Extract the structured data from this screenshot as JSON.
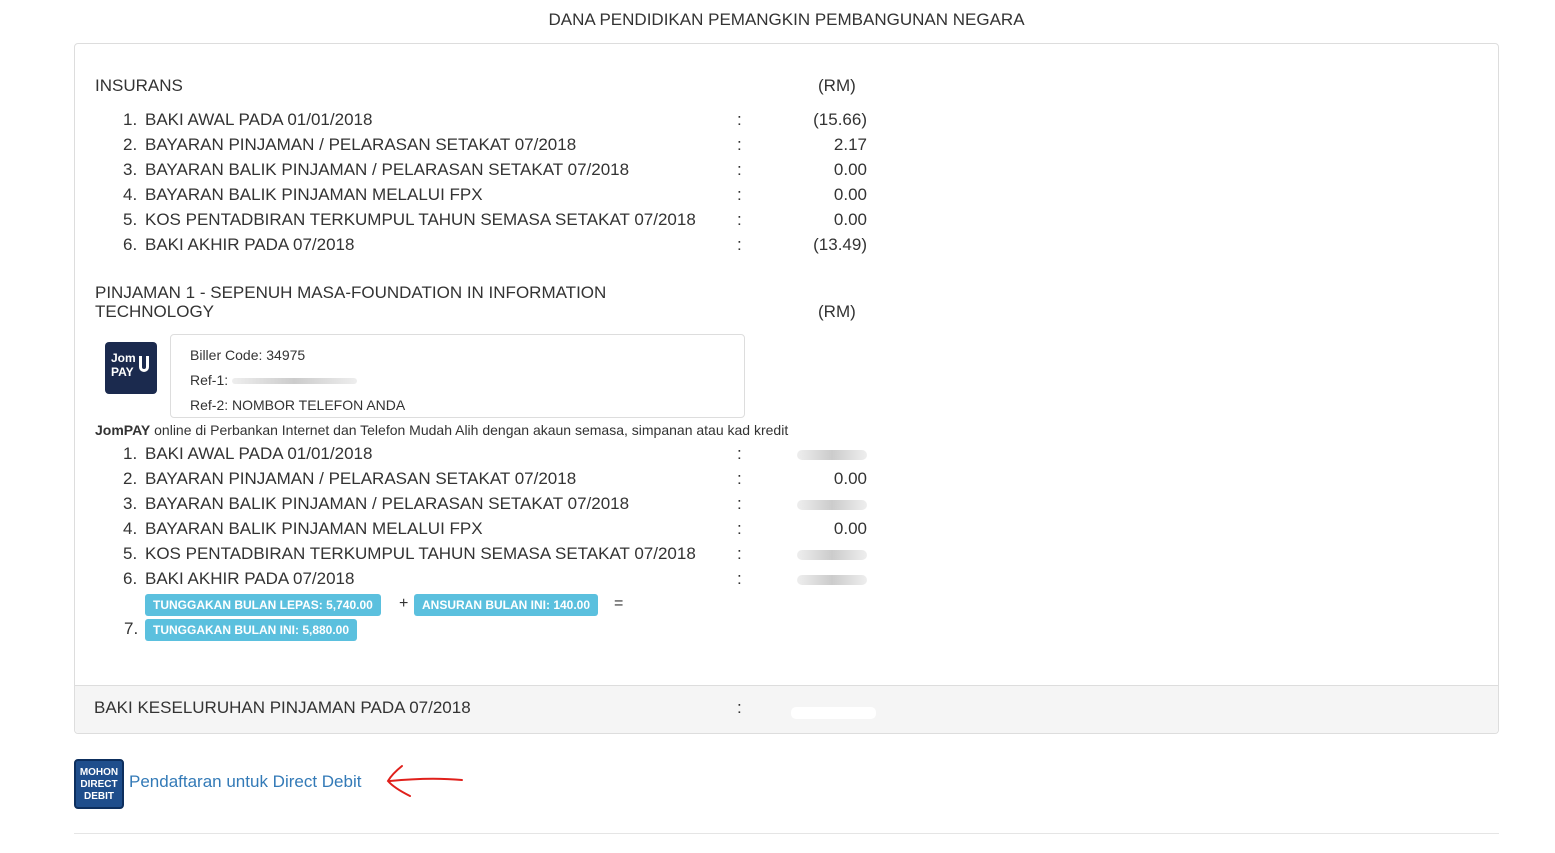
{
  "page_title": "DANA PENDIDIKAN PEMANGKIN PEMBANGUNAN NEGARA",
  "insurans": {
    "title": "INSURANS",
    "currency": "(RM)",
    "rows": [
      {
        "num": "1.",
        "label": "BAKI AWAL PADA 01/01/2018",
        "colon": ":",
        "value": "(15.66)"
      },
      {
        "num": "2.",
        "label": "BAYARAN PINJAMAN / PELARASAN SETAKAT 07/2018",
        "colon": ":",
        "value": "2.17"
      },
      {
        "num": "3.",
        "label": "BAYARAN BALIK PINJAMAN / PELARASAN SETAKAT 07/2018",
        "colon": ":",
        "value": "0.00"
      },
      {
        "num": "4.",
        "label": "BAYARAN BALIK PINJAMAN MELALUI FPX",
        "colon": ":",
        "value": "0.00"
      },
      {
        "num": "5.",
        "label": "KOS PENTADBIRAN TERKUMPUL TAHUN SEMASA SETAKAT 07/2018",
        "colon": ":",
        "value": "0.00"
      },
      {
        "num": "6.",
        "label": "BAKI AKHIR PADA 07/2018",
        "colon": ":",
        "value": "(13.49)"
      }
    ]
  },
  "pinjaman": {
    "title_line1": "PINJAMAN 1 - SEPENUH MASA-FOUNDATION IN INFORMATION",
    "title_line2": "TECHNOLOGY",
    "currency": "(RM)",
    "jompay_logo_top": "Jom",
    "jompay_logo_bottom": "PAY",
    "biller_code": "Biller Code: 34975",
    "ref1": "Ref-1:",
    "ref2": "Ref-2: NOMBOR TELEFON ANDA",
    "note_bold": "JomPAY",
    "note_text": " online di Perbankan Internet dan Telefon Mudah Alih dengan akaun semasa, simpanan atau kad kredit",
    "rows": [
      {
        "num": "1.",
        "label": "BAKI AWAL PADA 01/01/2018",
        "colon": ":",
        "value": ""
      },
      {
        "num": "2.",
        "label": "BAYARAN PINJAMAN / PELARASAN SETAKAT 07/2018",
        "colon": ":",
        "value": "0.00"
      },
      {
        "num": "3.",
        "label": "BAYARAN BALIK PINJAMAN / PELARASAN SETAKAT 07/2018",
        "colon": ":",
        "value": ""
      },
      {
        "num": "4.",
        "label": "BAYARAN BALIK PINJAMAN MELALUI FPX",
        "colon": ":",
        "value": "0.00"
      },
      {
        "num": "5.",
        "label": "KOS PENTADBIRAN TERKUMPUL TAHUN SEMASA SETAKAT 07/2018",
        "colon": ":",
        "value": ""
      },
      {
        "num": "6.",
        "label": "BAKI AKHIR PADA 07/2018",
        "colon": ":",
        "value": ""
      }
    ],
    "badge_tunggakan_lepas": "TUNGGAKAN BULAN LEPAS: 5,740.00",
    "plus": "+",
    "badge_ansuran": "ANSURAN BULAN INI: 140.00",
    "equals": "=",
    "row7_num": "7.",
    "badge_tunggakan_ini": "TUNGGAKAN BULAN INI: 5,880.00"
  },
  "footer": {
    "label": "BAKI KESELURUHAN PINJAMAN PADA 07/2018",
    "colon": ":"
  },
  "direct_debit": {
    "logo_lines": [
      "MOHON",
      "DIRECT",
      "DEBIT"
    ],
    "link_text": "Pendaftaran untuk Direct Debit",
    "arrow_color": "#e0201b",
    "link_color": "#337ab7",
    "badge_color": "#5bc0de"
  }
}
